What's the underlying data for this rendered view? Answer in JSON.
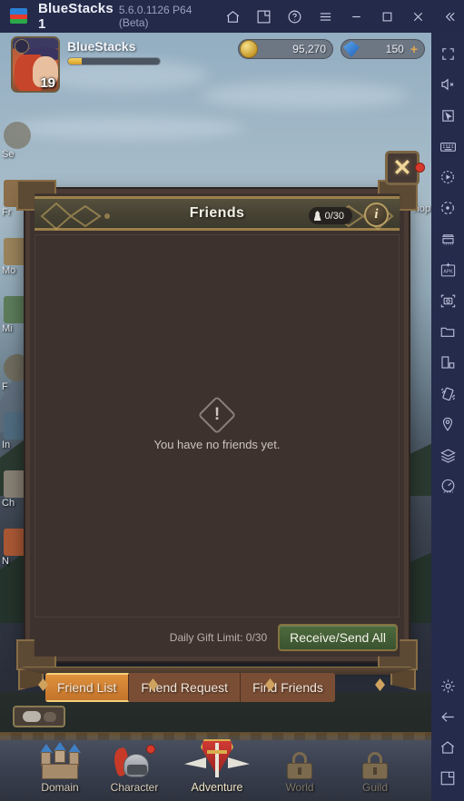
{
  "titlebar": {
    "app_name": "BlueStacks 1",
    "version": "5.6.0.1126 P64 (Beta)",
    "logo_icon": "bluestacks-logo",
    "buttons": [
      {
        "name": "home-icon",
        "label": "Home"
      },
      {
        "name": "multi-instance-icon",
        "label": "Instance Manager"
      },
      {
        "name": "help-icon",
        "label": "Help"
      },
      {
        "name": "menu-icon",
        "label": "Menu"
      },
      {
        "name": "minimize-icon",
        "label": "Minimize"
      },
      {
        "name": "maximize-icon",
        "label": "Maximize"
      },
      {
        "name": "close-icon",
        "label": "Close"
      },
      {
        "name": "collapse-icon",
        "label": "Collapse"
      }
    ]
  },
  "game_header": {
    "player_name": "BlueStacks",
    "player_level": "19",
    "xp_percent": 15,
    "gold": "95,270",
    "gems": "150",
    "gem_plus": "+"
  },
  "left_menu": [
    {
      "label": "Se"
    },
    {
      "label": "Fr"
    },
    {
      "label": "Mo"
    },
    {
      "label": "Mi"
    },
    {
      "label": "F"
    },
    {
      "label": "In"
    },
    {
      "label": "Ch"
    },
    {
      "label": "N"
    }
  ],
  "shop_tab": {
    "label": "hop"
  },
  "dialog": {
    "title": "Friends",
    "count": "0/30",
    "info_label": "i",
    "empty_message": "You have no friends yet.",
    "gift_limit": "Daily Gift Limit: 0/30",
    "receive_send_label": "Receive/Send All",
    "close_label": "✕"
  },
  "tabs": [
    {
      "label": "Friend List",
      "active": true
    },
    {
      "label": "Friend Request",
      "active": false
    },
    {
      "label": "Find Friends",
      "active": false
    }
  ],
  "bottom_nav": [
    {
      "label": "Domain",
      "icon": "castle-icon",
      "locked": false,
      "badge": false
    },
    {
      "label": "Character",
      "icon": "helmet-icon",
      "locked": false,
      "badge": true
    },
    {
      "label": "Adventure",
      "icon": "shield-sword-icon",
      "locked": false,
      "badge": false
    },
    {
      "label": "World",
      "icon": "lock-icon",
      "locked": true,
      "badge": false
    },
    {
      "label": "Guild",
      "icon": "lock-icon",
      "locked": true,
      "badge": false
    }
  ],
  "sidebar_top": [
    {
      "name": "fullscreen-icon"
    },
    {
      "name": "mute-icon"
    },
    {
      "name": "cursor-icon"
    },
    {
      "name": "keyboard-icon"
    },
    {
      "name": "macro-record-icon"
    },
    {
      "name": "rotate-icon"
    },
    {
      "name": "multi-instance-sync-icon"
    },
    {
      "name": "apk-install-icon"
    },
    {
      "name": "screenshot-icon"
    },
    {
      "name": "folder-icon"
    },
    {
      "name": "split-screen-icon"
    },
    {
      "name": "shake-icon"
    },
    {
      "name": "location-pin-icon"
    },
    {
      "name": "layers-icon"
    },
    {
      "name": "performance-gauge-icon"
    }
  ],
  "sidebar_bottom": [
    {
      "name": "gear-icon"
    },
    {
      "name": "back-arrow-icon"
    },
    {
      "name": "home-icon"
    },
    {
      "name": "recents-icon"
    }
  ],
  "colors": {
    "titlebar_bg": "#242a4a",
    "sidebar_bg": "#252b4b",
    "dialog_bg": "#3e322e",
    "dialog_frame": "#4a3b35",
    "header_gold": "#9b8049",
    "tab_active": "#e0913d",
    "button_green": "#4d6b3e",
    "badge_red": "#d83b2b"
  }
}
